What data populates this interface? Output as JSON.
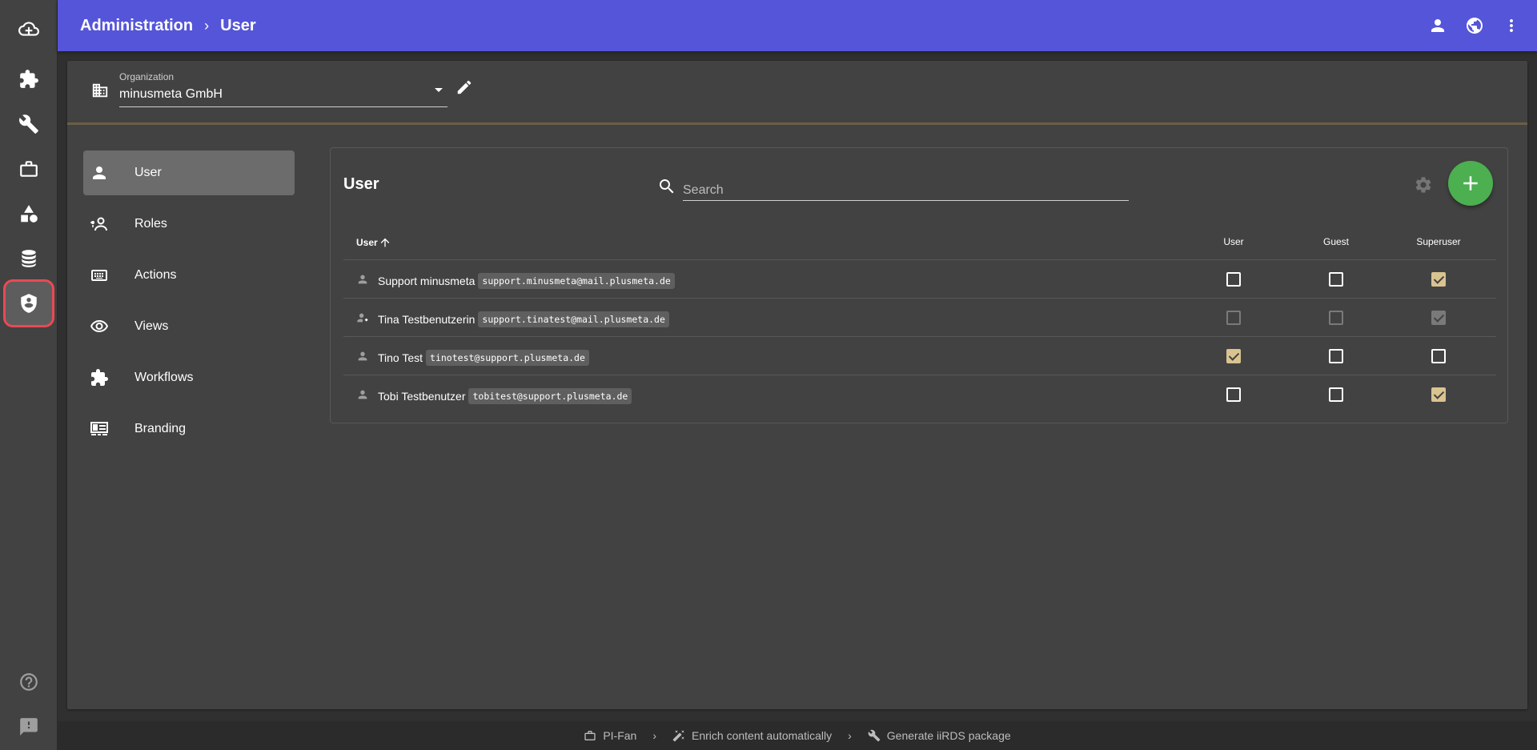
{
  "header": {
    "crumbs": [
      "Administration",
      "User"
    ],
    "separator": "›"
  },
  "rail": {
    "icons": [
      "cloud-add-icon",
      "puzzle-icon",
      "wrench-icon",
      "briefcase-icon",
      "shapes-icon",
      "database-icon",
      "admin-shield-icon",
      "help-icon",
      "feedback-icon"
    ],
    "selected": "admin-shield-icon",
    "highlight_color": "#e94a55"
  },
  "organization": {
    "label": "Organization",
    "value": "minusmeta GmbH"
  },
  "subnav": {
    "items": [
      {
        "label": "User",
        "icon": "person-icon",
        "active": true
      },
      {
        "label": "Roles",
        "icon": "roles-icon",
        "active": false
      },
      {
        "label": "Actions",
        "icon": "keyboard-icon",
        "active": false
      },
      {
        "label": "Views",
        "icon": "eye-icon",
        "active": false
      },
      {
        "label": "Workflows",
        "icon": "puzzle-icon",
        "active": false
      },
      {
        "label": "Branding",
        "icon": "branding-icon",
        "active": false
      }
    ]
  },
  "users_card": {
    "title": "User",
    "search_placeholder": "Search",
    "columns": {
      "user": "User",
      "role_user": "User",
      "guest": "Guest",
      "superuser": "Superuser"
    },
    "rows": [
      {
        "name": "Support minusmeta",
        "email": "support.minusmeta@mail.plusmeta.de",
        "user": false,
        "guest": false,
        "superuser": true,
        "disabled": false
      },
      {
        "name": "Tina Testbenutzerin",
        "email": "support.tinatest@mail.plusmeta.de",
        "user": false,
        "guest": false,
        "superuser": true,
        "disabled": true
      },
      {
        "name": "Tino Test",
        "email": "tinotest@support.plusmeta.de",
        "user": true,
        "guest": false,
        "superuser": false,
        "disabled": false
      },
      {
        "name": "Tobi Testbenutzer",
        "email": "tobitest@support.plusmeta.de",
        "user": false,
        "guest": false,
        "superuser": true,
        "disabled": false
      }
    ]
  },
  "footer": {
    "items": [
      "PI-Fan",
      "Enrich content automatically",
      "Generate iiRDS package"
    ]
  },
  "colors": {
    "topbar": "#5555d9",
    "add_button": "#4caf50",
    "checkbox_checked": "#d9c38f"
  }
}
